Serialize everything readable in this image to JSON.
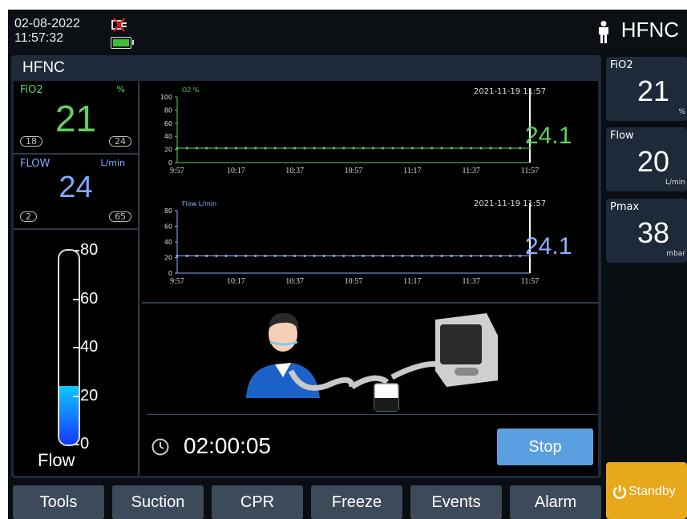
{
  "status": {
    "date": "02-08-2022",
    "time": "11:57:32",
    "mode": "HFNC",
    "plug_icon": "no-ac-power-icon",
    "battery_icon": "battery-icon",
    "battery_color": "#39c13a"
  },
  "main": {
    "title": "HFNC",
    "fio2": {
      "label": "FiO2",
      "unit": "%",
      "value": "21",
      "low": "18",
      "high": "24",
      "color": "#5fd15f"
    },
    "flow": {
      "label": "FLOW",
      "unit": "L/min",
      "value": "24",
      "low": "2",
      "high": "65",
      "color": "#7fa8ff"
    },
    "flow_bar": {
      "label": "Flow",
      "scale": [
        "80",
        "60",
        "40",
        "20",
        "0"
      ],
      "level": 24,
      "max": 80
    }
  },
  "waves": {
    "o2": {
      "label": "O2",
      "unit": "%",
      "timestamp": "2021-11-19  11:57",
      "readout": "24.1",
      "color": "#5fd15f",
      "yticks": [
        "100",
        "80",
        "60",
        "40",
        "20",
        "0"
      ],
      "ymax": 100,
      "level": 22
    },
    "flow": {
      "label": "Flow",
      "unit": "L/min",
      "timestamp": "2021-11-19  11:57",
      "readout": "24.1",
      "color": "#8fb0ff",
      "yticks": [
        "80",
        "60",
        "40",
        "20",
        "0"
      ],
      "ymax": 80,
      "level": 22
    },
    "xticks": [
      "9:57",
      "10:17",
      "10:37",
      "10:57",
      "11:17",
      "11:37",
      "11:57"
    ]
  },
  "therapy": {
    "timer": "02:00:05",
    "stop_label": "Stop"
  },
  "side": [
    {
      "label": "FiO2",
      "value": "21",
      "unit": "%"
    },
    {
      "label": "Flow",
      "value": "20",
      "unit": "L/min"
    },
    {
      "label": "Pmax",
      "value": "38",
      "unit": "mbar"
    }
  ],
  "standby_label": "Standby",
  "buttons": [
    "Tools",
    "Suction",
    "CPR",
    "Freeze",
    "Events",
    "Alarm"
  ]
}
